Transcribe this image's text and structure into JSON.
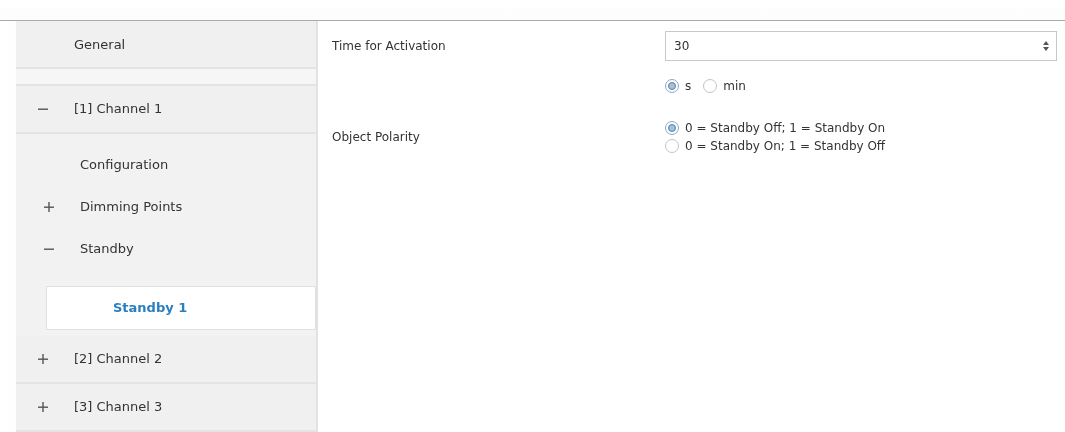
{
  "sidebar": {
    "items": [
      {
        "label": "General",
        "selected": false
      },
      {
        "label": "[1] Channel 1",
        "selected": false,
        "expanded": true,
        "children": [
          {
            "label": "Configuration",
            "selected": false
          },
          {
            "label": "Dimming Points",
            "selected": false,
            "expanded": false
          },
          {
            "label": "Standby",
            "selected": false,
            "expanded": true,
            "children": [
              {
                "label": "Standby 1",
                "selected": true
              }
            ]
          }
        ]
      },
      {
        "label": "[2] Channel 2",
        "selected": false,
        "expanded": false
      },
      {
        "label": "[3] Channel 3",
        "selected": false,
        "expanded": false
      }
    ]
  },
  "parameters": [
    {
      "kind": "spinner",
      "label": "Time for Activation",
      "value": "30"
    },
    {
      "kind": "radio",
      "options": [
        {
          "label": "s",
          "selected": true
        },
        {
          "label": "min",
          "selected": false
        }
      ],
      "inline": true
    },
    {
      "kind": "radio",
      "label": "Object Polarity",
      "options": [
        {
          "label": "0 = Standby Off; 1 = Standby On",
          "selected": true
        },
        {
          "label": "0 = Standby On; 1 = Standby Off",
          "selected": false
        }
      ],
      "inline": false
    }
  ]
}
